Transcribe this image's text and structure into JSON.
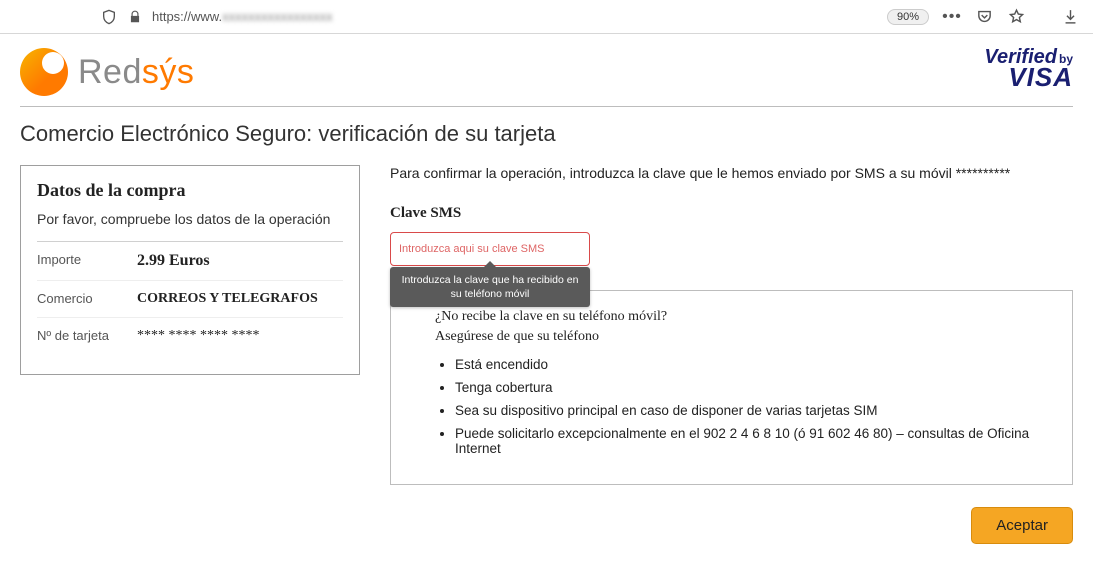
{
  "browser": {
    "url_prefix": "https://www.",
    "url_blur": "xxxxxxxxxxxxxxxxx",
    "zoom": "90%"
  },
  "brand": {
    "name_pre": "Red",
    "name_accent": "sýs",
    "verified_1": "Verified",
    "verified_by": "by",
    "verified_2": "VISA"
  },
  "page_title": "Comercio Electrónico Seguro: verificación de su tarjeta",
  "purchase": {
    "box_title": "Datos de la compra",
    "box_sub": "Por favor, compruebe los datos de la operación",
    "rows": {
      "amount_label": "Importe",
      "amount_val": "2.99 Euros",
      "merchant_label": "Comercio",
      "merchant_val": "CORREOS Y TELEGRAFOS",
      "card_label": "Nº de tarjeta",
      "card_val": "**** **** **** ****"
    }
  },
  "right": {
    "instruction": "Para confirmar la operación, introduzca la clave que le hemos enviado por SMS a su móvil **********",
    "field_label": "Clave SMS",
    "placeholder": "Introduzca aqui su clave SMS",
    "tooltip": "Introduzca la clave que ha recibido en su teléfono móvil",
    "help": {
      "q1": "¿No recibe la clave en su teléfono móvil?",
      "q2": "Asegúrese de que su teléfono",
      "items": [
        "Está encendido",
        "Tenga cobertura",
        "Sea su dispositivo principal en caso de disponer de varias tarjetas SIM",
        "Puede solicitarlo excepcionalmente en el 902 2 4 6 8 10 (ó 91 602 46 80) – consultas de Oficina Internet"
      ]
    }
  },
  "accept_label": "Aceptar"
}
